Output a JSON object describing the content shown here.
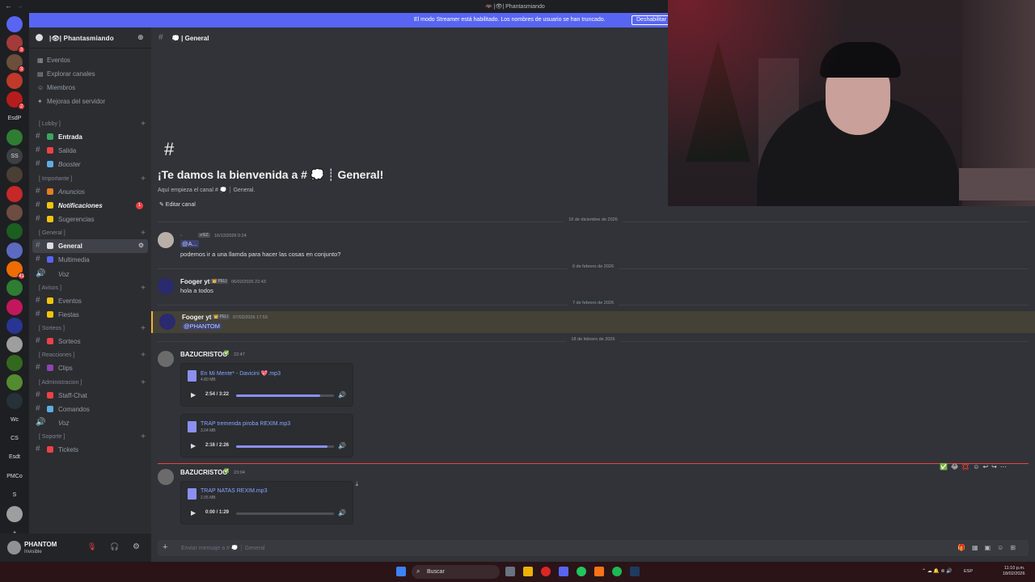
{
  "titlebar": {
    "title": "🦇 |👁| Phantasmiando",
    "back": "←",
    "forward": "→"
  },
  "banner": {
    "text": "El modo Streamer está habilitado. Los nombres de usuario se han truncado.",
    "button": "Deshabilitar"
  },
  "guild": {
    "name": "|👁| Phantasmiando",
    "chevron": "⌄"
  },
  "rail_servers": [
    {
      "label": "",
      "color": "#5865f2",
      "badge": ""
    },
    {
      "label": "",
      "color": "#a33b3b",
      "badge": "3"
    },
    {
      "label": "",
      "color": "#6b4f3a",
      "badge": "3"
    },
    {
      "label": "",
      "color": "#c0392b",
      "badge": ""
    },
    {
      "label": "",
      "color": "#b71c1c",
      "badge": "2"
    },
    {
      "label": "EsdP",
      "color": "#1e1f22",
      "badge": ""
    },
    {
      "label": "",
      "color": "#2e7d32",
      "badge": ""
    },
    {
      "label": "SS",
      "color": "#3c4043",
      "badge": ""
    },
    {
      "label": "",
      "color": "#4a3f35",
      "badge": ""
    },
    {
      "label": "",
      "color": "#c62828",
      "badge": ""
    },
    {
      "label": "",
      "color": "#6d4c41",
      "badge": ""
    },
    {
      "label": "",
      "color": "#1b5e20",
      "badge": ""
    },
    {
      "label": "",
      "color": "#5c6bc0",
      "badge": ""
    },
    {
      "label": "",
      "color": "#ef6c00",
      "badge": "41"
    },
    {
      "label": "",
      "color": "#2e7d32",
      "badge": ""
    },
    {
      "label": "",
      "color": "#c2185b",
      "badge": ""
    },
    {
      "label": "",
      "color": "#283593",
      "badge": ""
    },
    {
      "label": "",
      "color": "#9e9e9e",
      "badge": ""
    },
    {
      "label": "",
      "color": "#33691e",
      "badge": ""
    },
    {
      "label": "",
      "color": "#558b2f",
      "badge": ""
    },
    {
      "label": "",
      "color": "#263238",
      "badge": ""
    },
    {
      "label": "Wc",
      "color": "#1e1f22",
      "badge": ""
    },
    {
      "label": "CS",
      "color": "#1e1f22",
      "badge": ""
    },
    {
      "label": "Esdt",
      "color": "#1e1f22",
      "badge": ""
    },
    {
      "label": "PMCo",
      "color": "#1e1f22",
      "badge": ""
    },
    {
      "label": "S",
      "color": "#1e1f22",
      "badge": ""
    },
    {
      "label": "",
      "color": "#9e9e9e",
      "badge": ""
    },
    {
      "label": "+",
      "color": "#1e1f22",
      "badge": ""
    }
  ],
  "nav": [
    {
      "icon": "▦",
      "label": "Eventos"
    },
    {
      "icon": "▤",
      "label": "Explorar canales"
    },
    {
      "icon": "☺",
      "label": "Miembros"
    },
    {
      "icon": "✦",
      "label": "Mejoras del servidor"
    }
  ],
  "categories": [
    {
      "label": "[ Lobby ]",
      "channels": [
        {
          "label": "Entrada",
          "emo": "#3ba55c",
          "bold": true,
          "italic": false
        },
        {
          "label": "Salida",
          "emo": "#ed4245",
          "bold": false,
          "italic": false
        },
        {
          "label": "Booster",
          "emo": "#5dade2",
          "bold": false,
          "italic": true
        }
      ]
    },
    {
      "label": "[ Importante ]",
      "channels": [
        {
          "label": "Anuncios",
          "emo": "#e67e22",
          "bold": false,
          "italic": true
        },
        {
          "label": "Notificaciones",
          "emo": "#f1c40f",
          "bold": true,
          "italic": true,
          "badge": "1"
        },
        {
          "label": "Sugerencias",
          "emo": "#f1c40f",
          "bold": false,
          "italic": false
        }
      ]
    },
    {
      "label": "[ General ]",
      "channels": [
        {
          "label": "General",
          "emo": "#dbdee1",
          "bold": true,
          "italic": false,
          "active": true
        },
        {
          "label": "Multimedia",
          "emo": "#5865f2",
          "bold": false,
          "italic": false
        },
        {
          "label": "Voz",
          "emo": "",
          "bold": false,
          "italic": true,
          "voice": true
        }
      ]
    },
    {
      "label": "[ Avisos ]",
      "channels": [
        {
          "label": "Eventos",
          "emo": "#f1c40f",
          "bold": false,
          "italic": false
        },
        {
          "label": "Fiestas",
          "emo": "#f1c40f",
          "bold": false,
          "italic": false
        }
      ]
    },
    {
      "label": "[ Sorteos ]",
      "channels": [
        {
          "label": "Sorteos",
          "emo": "#ed4245",
          "bold": false,
          "italic": false
        }
      ]
    },
    {
      "label": "[ Reacciones ]",
      "channels": [
        {
          "label": "Clips",
          "emo": "#8e44ad",
          "bold": false,
          "italic": false
        }
      ]
    },
    {
      "label": "[ Administracion ]",
      "channels": [
        {
          "label": "Staff-Chat",
          "emo": "#ed4245",
          "bold": false,
          "italic": false
        },
        {
          "label": "Comandos",
          "emo": "#5dade2",
          "bold": false,
          "italic": false
        },
        {
          "label": "Voz",
          "emo": "",
          "bold": false,
          "italic": true,
          "voice": true
        }
      ]
    },
    {
      "label": "[ Soporte ]",
      "channels": [
        {
          "label": "Tickets",
          "emo": "#ed4245",
          "bold": false,
          "italic": false
        }
      ]
    }
  ],
  "user": {
    "name": "PHANTOM",
    "status": "Invisible"
  },
  "channel_header": {
    "name": "💭 | General"
  },
  "welcome": {
    "hash": "#",
    "title": "¡Te damos la bienvenida a # 💭 ┊ General!",
    "subtitle": "Aquí empieza el canal # 💭 ┊ General.",
    "edit": "✎ Editar canal"
  },
  "dates": [
    "16 de diciembre de 2026",
    "6 de febrero de 2026",
    "7 de febrero de 2026",
    "18 de febrero de 2026"
  ],
  "messages": [
    {
      "author": "·",
      "author_color": "#e74c3c",
      "tag": "✔EZ",
      "time": "16/12/2026 0:24",
      "mention": "@A...",
      "text": "podemos ir a una llamda para hacer las cosas en conjunto?"
    },
    {
      "author": "Fooger yt",
      "tag": "👑 PELI",
      "time": "06/02/2026 22:43",
      "text": "hola a todos"
    },
    {
      "author": "Fooger yt",
      "tag": "👑 PELI",
      "time": "07/02/2026 17:53",
      "mention": "@PHANTOM"
    },
    {
      "author": "BAZUCRISTOO",
      "tag": "✅",
      "time": "22:47"
    },
    {
      "author": "BAZUCRISTOO",
      "tag": "✅",
      "time": "23:04"
    }
  ],
  "attachments": [
    {
      "name": "En Mi Mente* - Davicini 💖.mp3",
      "size": "4.80 MB",
      "time": "2:54 / 3:22",
      "progress": 0.86
    },
    {
      "name": "TRAP tremenda piroba REXIM.mp3",
      "size": "3.04 MB",
      "time": "2:16 / 2:26",
      "progress": 0.93
    },
    {
      "name": "TRAP NATAS REXIM.mp3",
      "size": "2.05 MB",
      "time": "0:00 / 1:29",
      "progress": 0.0
    }
  ],
  "reactions": [
    "✅",
    "😂",
    "💢",
    "☺",
    "↩",
    "↪",
    "⋯"
  ],
  "composer": {
    "placeholder": "Enviar mensaje a # 💭 ┊ General",
    "tools": "🎁▦▣☺⊞"
  },
  "taskbar": {
    "search": "Buscar",
    "lang": "ESP",
    "time": "11:10 p.m.",
    "date": "18/02/2026",
    "tray": "⌃ ☁ 🔔 ⊚ 🔊"
  }
}
